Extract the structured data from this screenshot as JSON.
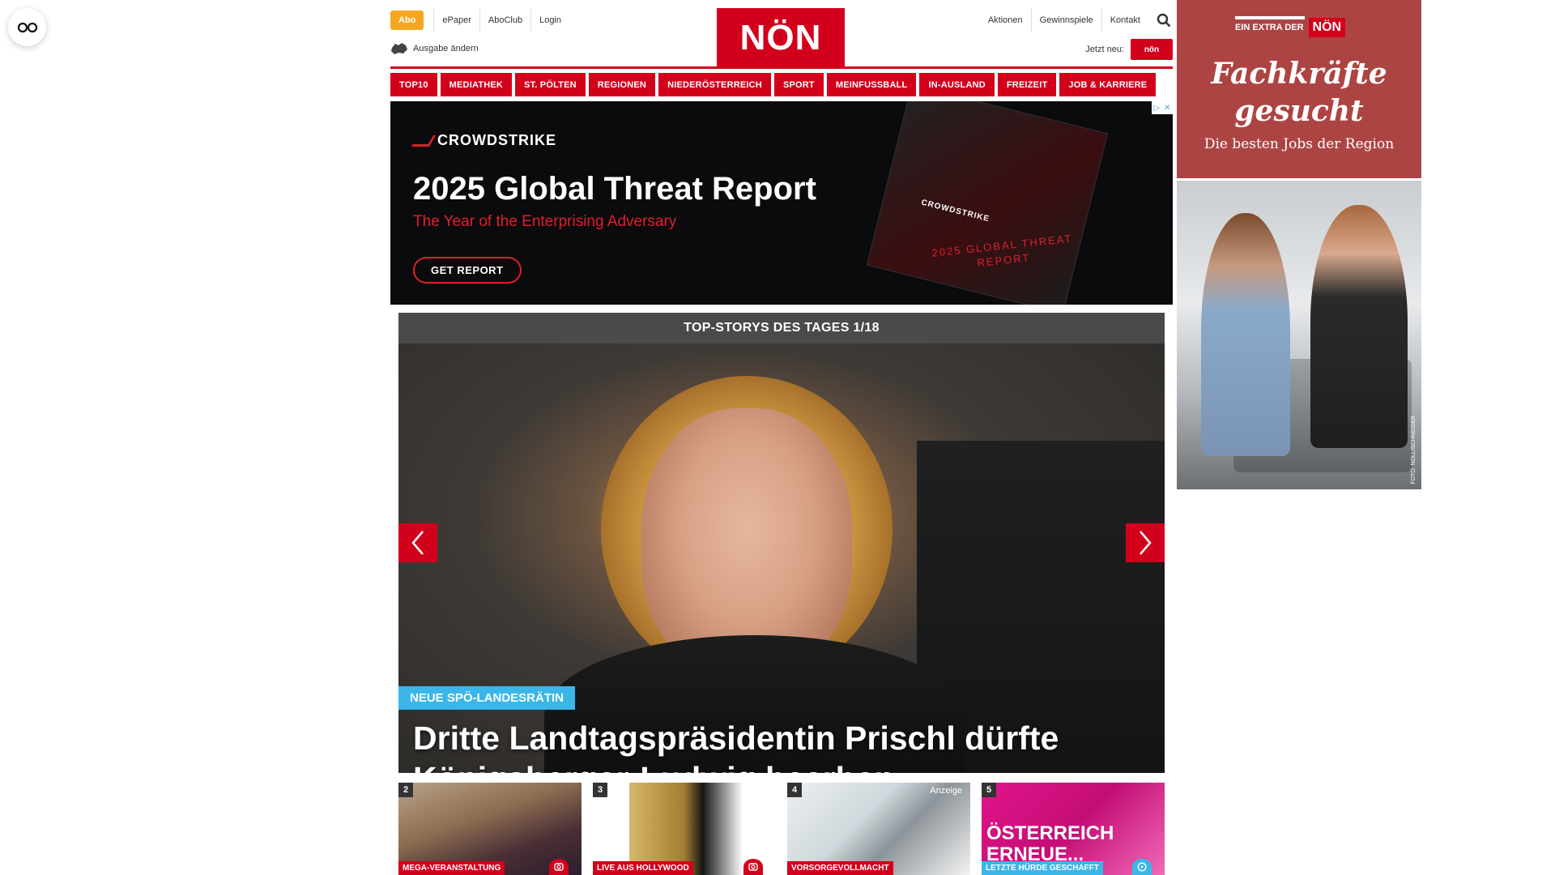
{
  "topnav_left": {
    "abo": "Abo",
    "links": [
      "ePaper",
      "AboClub",
      "Login"
    ],
    "ausgabe": "Ausgabe ändern"
  },
  "logo": "NÖN",
  "topnav_right": {
    "links": [
      "Aktionen",
      "Gewinnspiele",
      "Kontakt"
    ],
    "jetzt": "Jetzt neu:",
    "jetzt_badge": "nön"
  },
  "categories": [
    "TOP10",
    "MEDIATHEK",
    "ST. PÖLTEN",
    "REGIONEN",
    "NIEDERÖSTERREICH",
    "SPORT",
    "MEINFUSSBALL",
    "IN-AUSLAND",
    "FREIZEIT",
    "JOB & KARRIERE"
  ],
  "ad": {
    "brand": "CROWDSTRIKE",
    "title": "2025 Global Threat Report",
    "subtitle": "The Year of the Enterprising Adversary",
    "button": "GET REPORT",
    "book_brand": "CROWDSTRIKE",
    "book_title": "2025 GLOBAL THREAT REPORT"
  },
  "topstory": {
    "header": "TOP-STORYS DES TAGES 1/18",
    "tag": "NEUE SPÖ-LANDESRÄTIN",
    "headline": "Dritte Landtagspräsidentin Prischl dürfte Königsberger-Ludwig beerben"
  },
  "teasers": [
    {
      "num": "2",
      "label": "MEGA-VERANSTALTUNG",
      "label_color": "red"
    },
    {
      "num": "3",
      "label": "LIVE AUS HOLLYWOOD",
      "label_color": "red"
    },
    {
      "num": "4",
      "label": "VORSORGEVOLLMACHT",
      "label_color": "red",
      "anzeige": "Anzeige"
    },
    {
      "num": "5",
      "label": "LETZTE HÜRDE GESCHAFFT",
      "label_color": "blue",
      "overlay_text": "ÖSTERREICH ERNEUE..."
    }
  ],
  "side_ad": {
    "extra_label": "EIN EXTRA DER",
    "extra_logo": "NÖN",
    "headline": "Fachkräfte gesucht",
    "subline": "Die besten Jobs der Region",
    "credit": "FOTO: NOLL/SCHNEIDER"
  },
  "colors": {
    "brand_red": "#d3001c",
    "accent_blue": "#3ab6e8",
    "abo_orange": "#f5a623",
    "side_ad_red": "#ad4444"
  }
}
